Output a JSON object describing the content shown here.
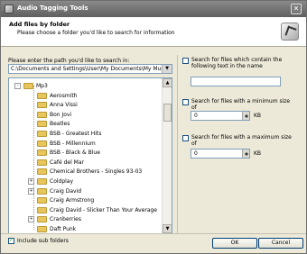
{
  "window": {
    "title": "Audio Tagging Tools"
  },
  "header": {
    "title": "Add files by folder",
    "subtitle": "Please choose a folder you'd like to search for information"
  },
  "path": {
    "label": "Please enter the path you'd like to search in:",
    "value": "C:\\Documents and Settings\\User\\My Documents\\My Music"
  },
  "tree": {
    "items": [
      {
        "label": "Mp3",
        "level": 0,
        "expander": "-"
      },
      {
        "label": "Aerosmith",
        "level": 1,
        "expander": ""
      },
      {
        "label": "Anna Vissi",
        "level": 1,
        "expander": ""
      },
      {
        "label": "Bon Jovi",
        "level": 1,
        "expander": ""
      },
      {
        "label": "Beatles",
        "level": 1,
        "expander": ""
      },
      {
        "label": "BSB - Greatest Hits",
        "level": 1,
        "expander": ""
      },
      {
        "label": "BSB - Millennium",
        "level": 1,
        "expander": ""
      },
      {
        "label": "BSB - Black & Blue",
        "level": 1,
        "expander": ""
      },
      {
        "label": "Café del Mar",
        "level": 1,
        "expander": ""
      },
      {
        "label": "Chemical Brothers - Singles 93-03",
        "level": 1,
        "expander": ""
      },
      {
        "label": "Coldplay",
        "level": 1,
        "expander": "+"
      },
      {
        "label": "Craig David",
        "level": 1,
        "expander": "+"
      },
      {
        "label": "Craig Armstrong",
        "level": 1,
        "expander": ""
      },
      {
        "label": "Craig David - Slicker Than Your Average",
        "level": 1,
        "expander": ""
      },
      {
        "label": "Cranberries",
        "level": 1,
        "expander": "+"
      },
      {
        "label": "Daft Punk",
        "level": 1,
        "expander": ""
      }
    ]
  },
  "include_subfolders": {
    "label": "Include sub folders",
    "checked": true
  },
  "options": {
    "text_search": {
      "label": "Search for files which contain the following text in the name",
      "checked": false,
      "value": ""
    },
    "min_size": {
      "label": "Search for files with a minimum size of",
      "checked": false,
      "value": "0",
      "unit": "KB"
    },
    "max_size": {
      "label": "Search for files with a maximum size of",
      "checked": false,
      "value": "0",
      "unit": "KB"
    }
  },
  "buttons": {
    "ok": "OK",
    "cancel": "Cancel"
  },
  "icons": {
    "title": "app-icon",
    "header": "music-tag-icon",
    "close": "close-icon"
  }
}
